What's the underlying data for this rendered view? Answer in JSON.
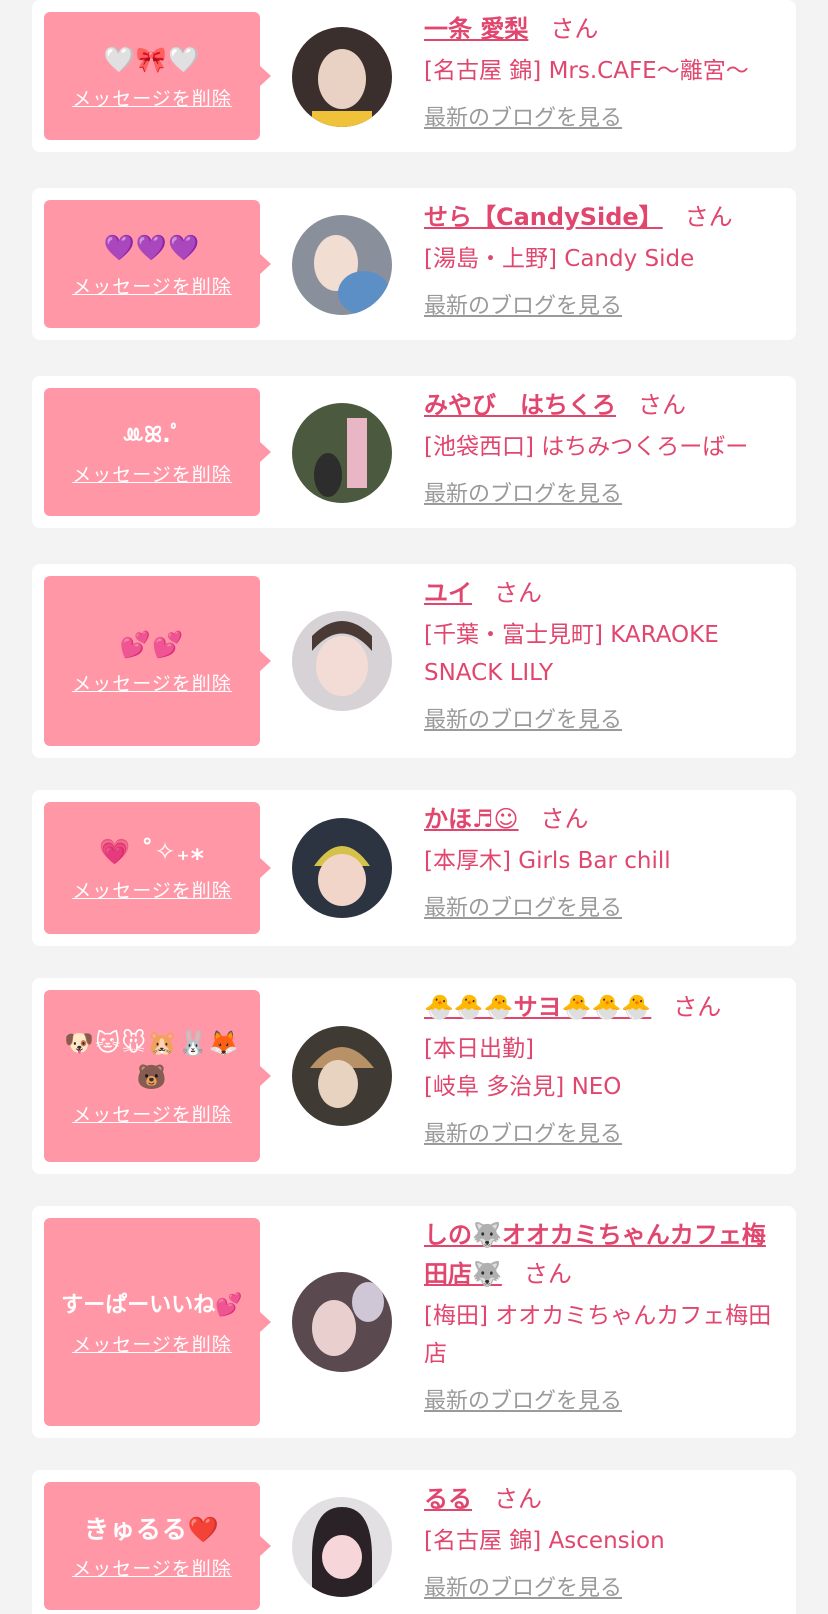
{
  "colors": {
    "background": "#f3f3f3",
    "card": "#ffffff",
    "bubble": "#ff97a7",
    "name_pink": "#e0466e",
    "link_gray": "#9a9a9a"
  },
  "labels": {
    "delete_message": "メッセージを削除",
    "san": "さん",
    "latest_blog": "最新のブログを見る"
  },
  "entries": [
    {
      "message": "🤍🎀🤍",
      "name": "一条 愛梨",
      "shop_lines": [
        "[名古屋 錦] Mrs.CAFE〜離宮〜"
      ],
      "avatar_icon": "portrait-photo",
      "avatar_colors": [
        "#3a2f2c",
        "#e9d2c4",
        "#f0c23a"
      ]
    },
    {
      "message": "💜💜💜",
      "name": "せら【CandySide】",
      "shop_lines": [
        "[湯島・上野] Candy Side"
      ],
      "avatar_icon": "portrait-photo",
      "avatar_colors": [
        "#8a8f9c",
        "#f1ddd2",
        "#5c8fc6"
      ]
    },
    {
      "message": "ꔛ‬︎ꕤ.ﾟ",
      "name": "みやび　はちくろ",
      "shop_lines": [
        "[池袋西口] はちみつくろーばー"
      ],
      "avatar_icon": "portrait-photo",
      "avatar_colors": [
        "#4b5a3e",
        "#e8b6c4",
        "#2d2d2d"
      ]
    },
    {
      "message": "💕💕",
      "name": "ユイ",
      "shop_lines": [
        "[千葉・富士見町] KARAOKE SNACK LILY"
      ],
      "avatar_icon": "portrait-photo",
      "avatar_colors": [
        "#d7d2d6",
        "#f3dcd6",
        "#4a3a36"
      ]
    },
    {
      "message": "💗 ˚✧₊⁎",
      "name": "かほ♬☺︎",
      "shop_lines": [
        "[本厚木] Girls Bar chill"
      ],
      "avatar_icon": "portrait-photo",
      "avatar_colors": [
        "#2b3440",
        "#d6c24a",
        "#f1d5c8"
      ]
    },
    {
      "message": "🐶🐱🐭🐹🐰🦊🐻",
      "name": "🐣🐣🐣サヨ🐣🐣🐣",
      "shop_lines": [
        "[本日出勤]",
        "[岐阜 多治見] NEO"
      ],
      "avatar_icon": "portrait-photo",
      "avatar_colors": [
        "#3f3a33",
        "#b89266",
        "#e8d2c0"
      ]
    },
    {
      "message": "すーぱーいいね💕",
      "name": "しの🐺オオカミちゃんカフェ梅田店🐺",
      "shop_lines": [
        "[梅田] オオカミちゃんカフェ梅田店"
      ],
      "avatar_icon": "portrait-photo",
      "avatar_colors": [
        "#5a4a50",
        "#e9d0cf",
        "#cfc7d6"
      ]
    },
    {
      "message": "きゅるる❤️",
      "name": "るる",
      "shop_lines": [
        "[名古屋 錦] Ascension"
      ],
      "avatar_icon": "portrait-photo",
      "avatar_colors": [
        "#e2e0e2",
        "#2a2226",
        "#f6d6d8"
      ]
    }
  ]
}
